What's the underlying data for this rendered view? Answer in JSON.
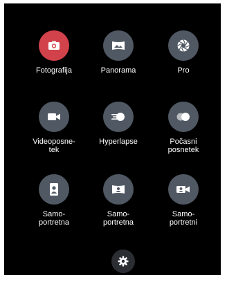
{
  "modes": [
    {
      "label": "Fotografija",
      "icon": "camera-icon",
      "active": true
    },
    {
      "label": "Panorama",
      "icon": "panorama-icon",
      "active": false
    },
    {
      "label": "Pro",
      "icon": "aperture-icon",
      "active": false
    },
    {
      "label": "Videoposne-\ntek",
      "icon": "video-camera-icon",
      "active": false
    },
    {
      "label": "Hyperlapse",
      "icon": "hyperlapse-icon",
      "active": false
    },
    {
      "label": "Počasni\nposnetek",
      "icon": "slow-motion-icon",
      "active": false
    },
    {
      "label": "Samo-\nportretna",
      "icon": "selfie-portrait-icon",
      "active": false
    },
    {
      "label": "Samo-\nportretna",
      "icon": "selfie-panorama-icon",
      "active": false
    },
    {
      "label": "Samo-\nportretni",
      "icon": "selfie-video-icon",
      "active": false
    }
  ],
  "settings": {
    "icon": "gear-icon"
  },
  "colors": {
    "background": "#000000",
    "mode_circle": "#505863",
    "active_circle": "#d2424a",
    "label": "#ffffff"
  }
}
